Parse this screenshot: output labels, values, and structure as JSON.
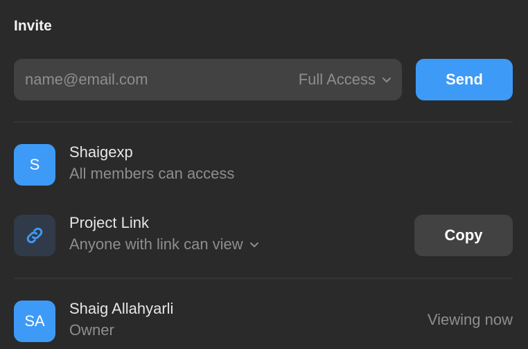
{
  "invite": {
    "title": "Invite",
    "email_placeholder": "name@email.com",
    "access_level": "Full Access",
    "send_label": "Send"
  },
  "entries": [
    {
      "avatar_text": "S",
      "name": "Shaigexp",
      "description": "All members can access"
    },
    {
      "avatar_icon": "link-icon",
      "name": "Project Link",
      "description": "Anyone with link can view",
      "action_label": "Copy"
    }
  ],
  "members": [
    {
      "avatar_text": "SA",
      "name": "Shaig Allahyarli",
      "role": "Owner",
      "status": "Viewing now"
    }
  ],
  "colors": {
    "background": "#2a2a2b",
    "field": "#424243",
    "accent": "#3d9af7",
    "muted_text": "#8e8e90",
    "link_avatar": "#313a48"
  }
}
